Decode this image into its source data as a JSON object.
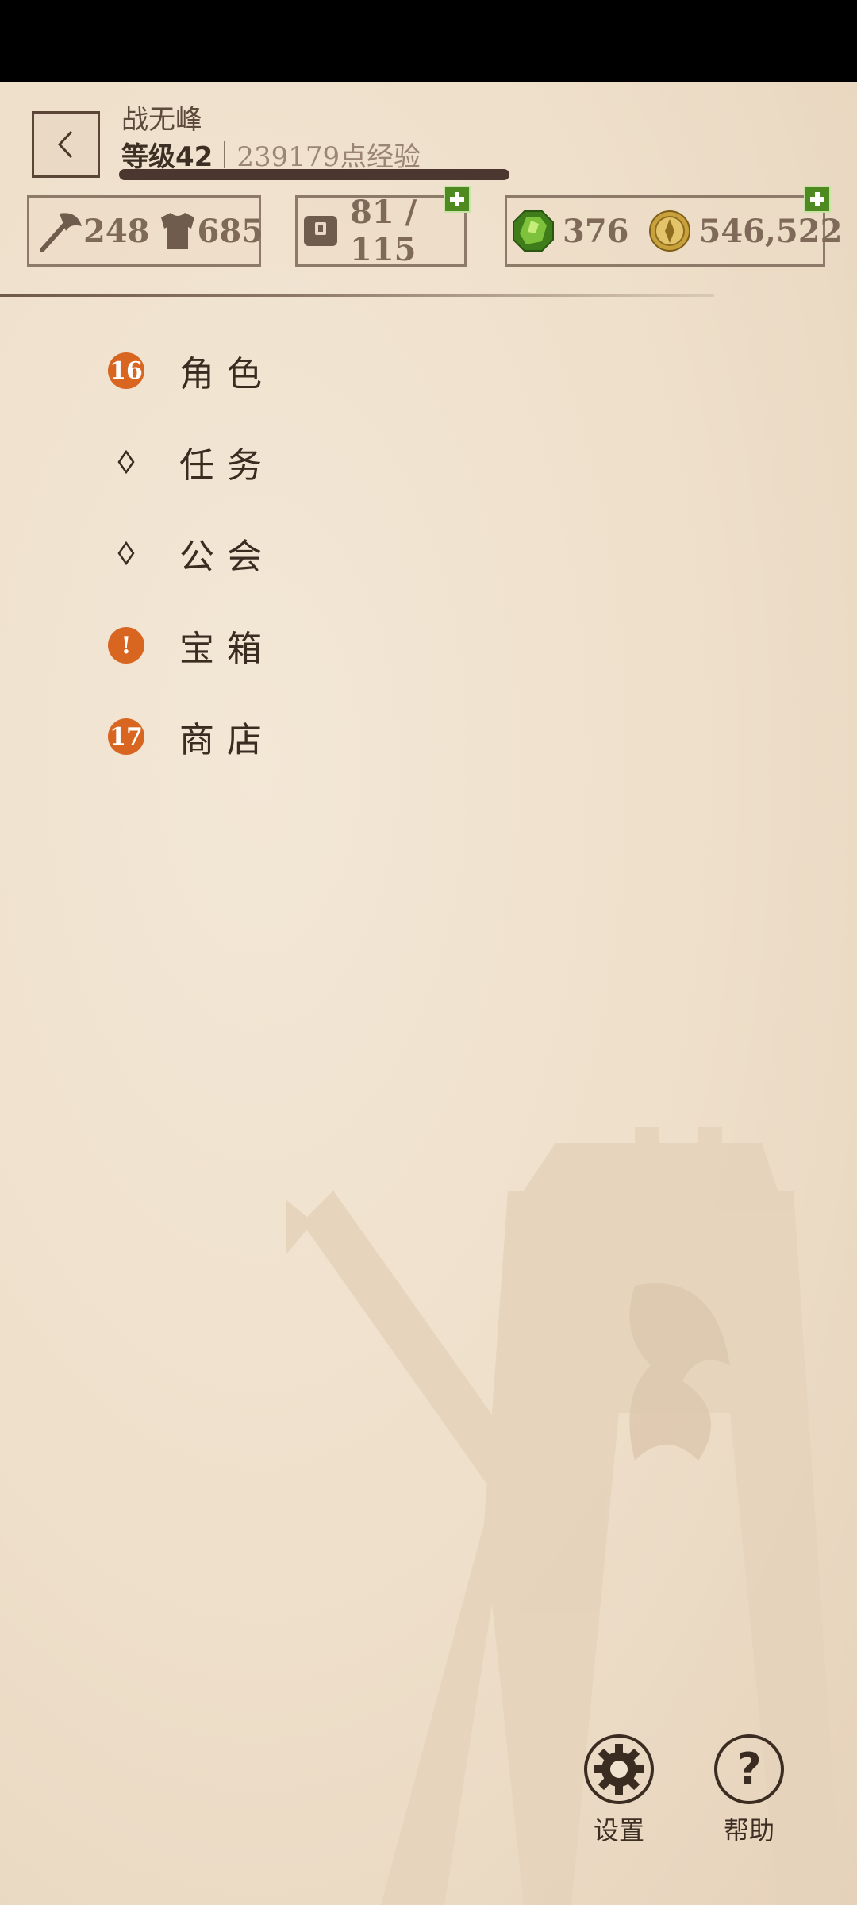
{
  "player": {
    "name": "战无峰",
    "level_label": "等级42",
    "xp_label": "239179点经验",
    "xp_progress": 1.0
  },
  "stats": {
    "attack": "248",
    "defense": "685",
    "inventory": "81 / 115",
    "gems": "376",
    "gold": "546,522"
  },
  "menu": [
    {
      "label": "角色",
      "marker": "badge",
      "badge": "16"
    },
    {
      "label": "任务",
      "marker": "diamond"
    },
    {
      "label": "公会",
      "marker": "diamond"
    },
    {
      "label": "宝箱",
      "marker": "badge",
      "badge": "!"
    },
    {
      "label": "商店",
      "marker": "badge",
      "badge": "17"
    }
  ],
  "bottom": {
    "settings_label": "设置",
    "help_label": "帮助",
    "help_glyph": "?"
  },
  "icons": {
    "back": "chevron-left-icon",
    "attack": "axe-icon",
    "defense": "armor-icon",
    "inventory": "chest-icon",
    "gems": "gem-icon",
    "gold": "gold-coin-icon",
    "add": "plus-icon",
    "settings": "gear-icon",
    "help": "help-icon",
    "watermark": "dragon-emblem-watermark"
  },
  "colors": {
    "background": "#efe2cf",
    "text_dark": "#3b2c22",
    "badge_orange": "#d86520",
    "plus_green": "#4e8a20",
    "xp_bar": "#4b3630"
  }
}
